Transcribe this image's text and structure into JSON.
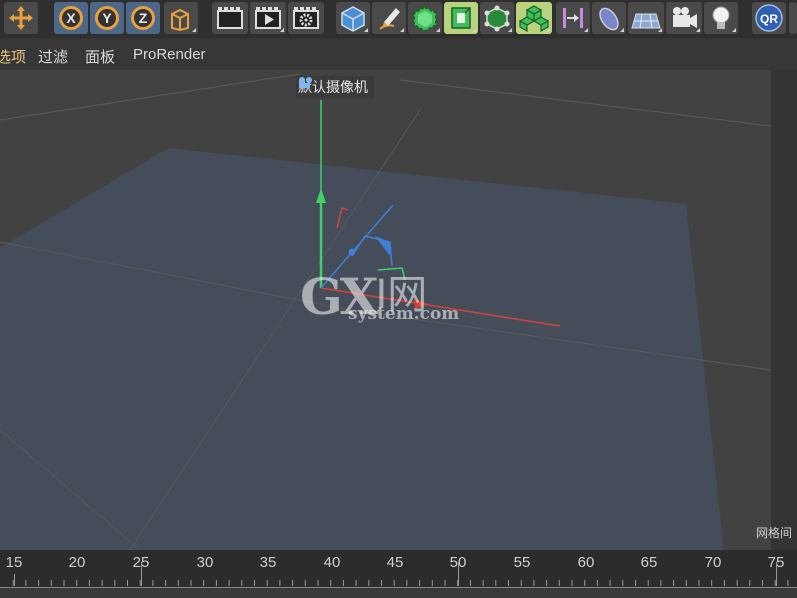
{
  "menu": {
    "items": [
      "选项",
      "过滤",
      "面板",
      "ProRender"
    ]
  },
  "viewport": {
    "camera_label": "默认摄像机",
    "grid_label": "网格间",
    "watermark_gx": "GX",
    "watermark_net": "I网",
    "watermark_sub": "system.com"
  },
  "timeline": {
    "ticks": [
      "15",
      "20",
      "25",
      "30",
      "35",
      "40",
      "45",
      "50",
      "55",
      "60",
      "65",
      "70",
      "75"
    ]
  },
  "colors": {
    "active_tool": "#b9d27d",
    "axis_x": "#d6423a",
    "axis_y": "#3fd06a",
    "axis_z": "#3f7fd6",
    "accent": "#e0a040"
  }
}
